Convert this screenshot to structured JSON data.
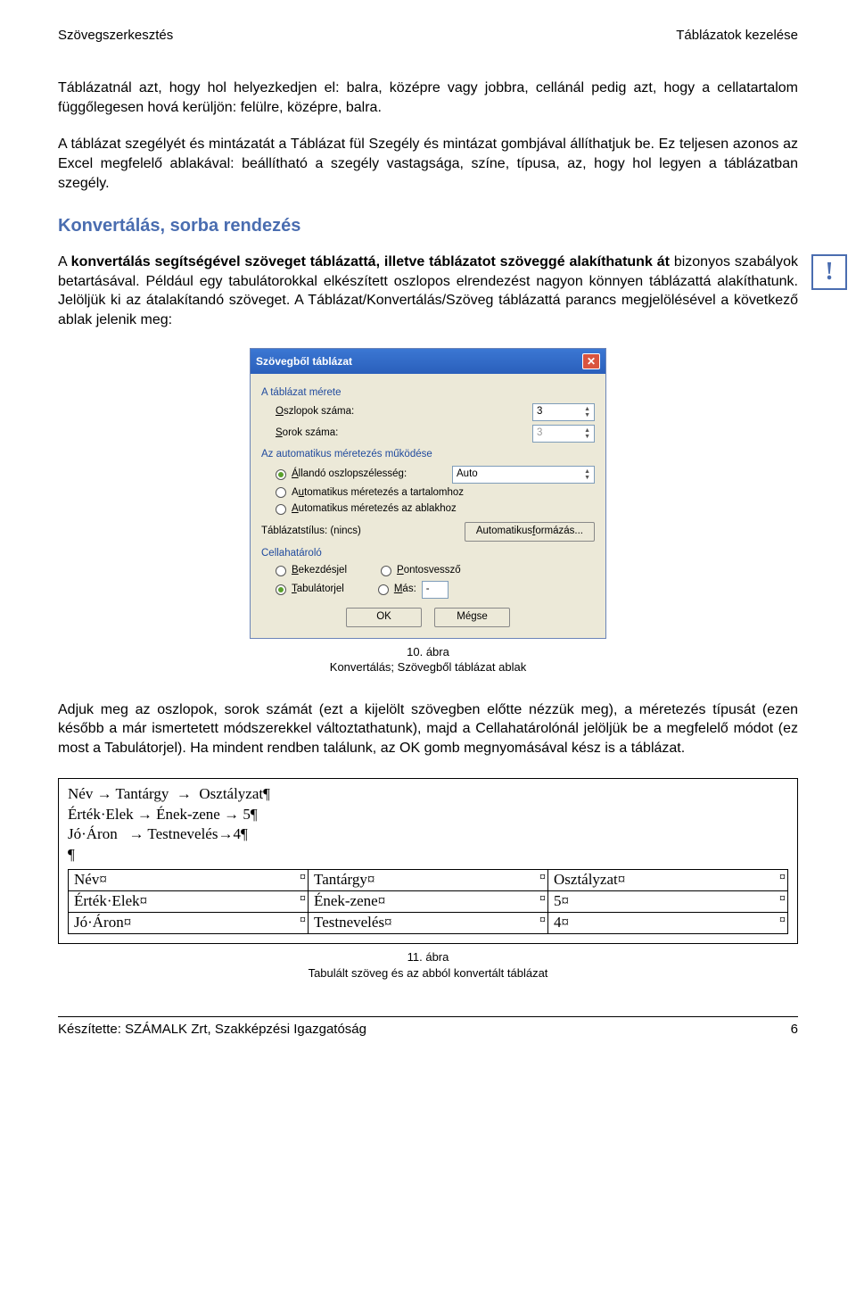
{
  "header": {
    "left": "Szövegszerkesztés",
    "right": "Táblázatok kezelése"
  },
  "para1": "Táblázatnál azt, hogy hol helyezkedjen el: balra, középre vagy jobbra, cellánál pedig azt, hogy a cellatartalom függőlegesen hová kerüljön: felülre, középre, balra.",
  "para2": "A táblázat szegélyét és mintázatát a Táblázat fül Szegély és mintázat gombjával állíthatjuk be. Ez teljesen azonos az Excel megfelelő ablakával: beállítható a szegély vastagsága, színe, típusa, az, hogy hol legyen a táblázatban szegély.",
  "section_title": "Konvertálás, sorba rendezés",
  "para3_full": "A konvertálás segítségével szöveget táblázattá, illetve táblázatot szöveggé alakíthatunk át bizonyos szabályok betartásával. Például egy tabulátorokkal elkészített oszlopos elrendezést nagyon könnyen táblázattá alakíthatunk. Jelöljük ki az átalakítandó szöveget. A Táblázat/Konvertálás/Szöveg táblázattá parancs megjelölésével a következő ablak jelenik meg:",
  "excl": "!",
  "dialog": {
    "title": "Szövegből táblázat",
    "group_size": "A táblázat mérete",
    "cols_label": "Oszlopok száma:",
    "cols_value": "3",
    "rows_label": "Sorok száma:",
    "rows_value": "3",
    "group_auto": "Az automatikus méretezés működése",
    "opt_fixed": "Állandó oszlopszélesség:",
    "fixed_value": "Auto",
    "opt_content": "Automatikus méretezés a tartalomhoz",
    "opt_window": "Automatikus méretezés az ablakhoz",
    "style_label": "Táblázatstílus: (nincs)",
    "autofmt_btn": "Automatikus formázás...",
    "group_delim": "Cellahatároló",
    "delim_para": "Bekezdésjel",
    "delim_semi": "Pontosvessző",
    "delim_tab": "Tabulátorjel",
    "delim_other": "Más:",
    "delim_other_val": "-",
    "ok": "OK",
    "cancel": "Mégse"
  },
  "caption10_a": "10. ábra",
  "caption10_b": "Konvertálás; Szövegből táblázat ablak",
  "para4": "Adjuk meg az oszlopok, sorok számát (ezt a kijelölt szövegben előtte nézzük meg), a méretezés típusát (ezen később a már ismertetett módszerekkel változtathatunk), majd a Cellahatárolónál jelöljük be a megfelelő módot (ez most a Tabulátorjel). Ha mindent rendben találunk, az OK gomb megnyomásával kész is a táblázat.",
  "tabtext": {
    "l1": "Név → Tantárgy  →  Osztályzat¶",
    "l2": "Érték·Elek → Ének-zene → 5¶",
    "l3": "Jó·Áron   → Testnevelés→4¶",
    "l4": "¶"
  },
  "table_rows": [
    [
      "Név¤",
      "Tantárgy¤",
      "Osztályzat¤"
    ],
    [
      "Érték·Elek¤",
      "Ének-zene¤",
      "5¤"
    ],
    [
      "Jó·Áron¤",
      "Testnevelés¤",
      "4¤"
    ]
  ],
  "rowmark": "¤",
  "caption11_a": "11. ábra",
  "caption11_b": "Tabulált szöveg és az abból konvertált táblázat",
  "footer": {
    "left": "Készítette: SZÁMALK Zrt, Szakképzési Igazgatóság",
    "right": "6"
  }
}
